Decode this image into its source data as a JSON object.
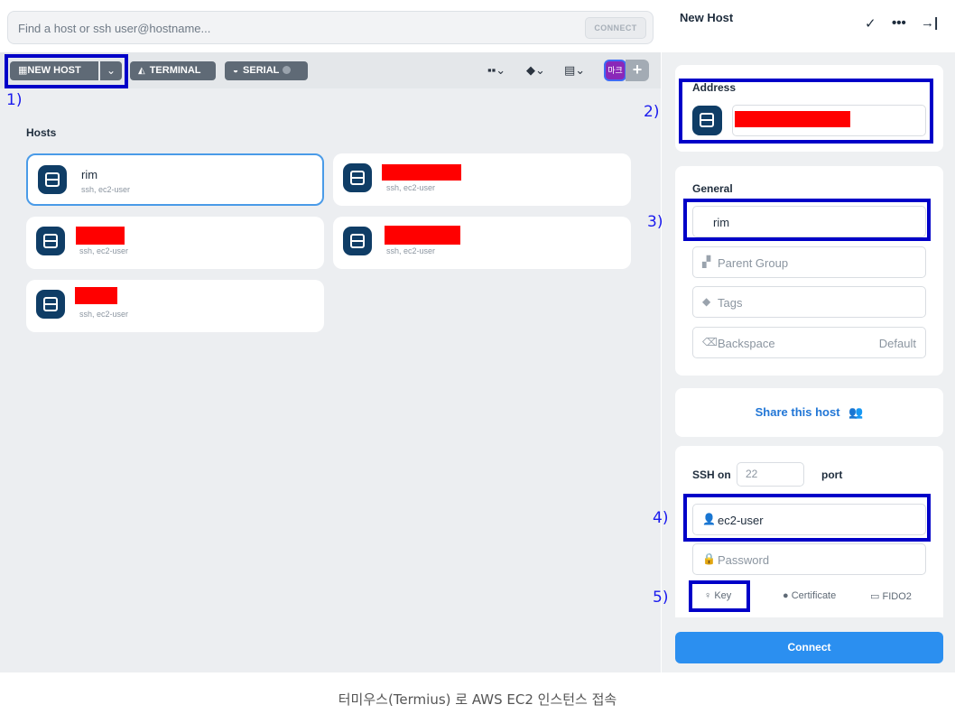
{
  "search": {
    "placeholder": "Find a host or ssh user@hostname...",
    "connect_label": "CONNECT"
  },
  "toolbar": {
    "new_host_label": "NEW HOST",
    "terminal_label": "TERMINAL",
    "serial_label": "SERIAL",
    "avatar_text": "마크"
  },
  "hosts": {
    "title": "Hosts",
    "items": [
      {
        "name": "rim",
        "sub": "ssh, ec2-user"
      },
      {
        "name": "",
        "sub": "ssh, ec2-user"
      },
      {
        "name": "",
        "sub": "ssh, ec2-user"
      },
      {
        "name": "",
        "sub": "ssh, ec2-user"
      },
      {
        "name": "",
        "sub": "ssh, ec2-user"
      }
    ]
  },
  "panel": {
    "title": "New Host",
    "address": {
      "title": "Address"
    },
    "general": {
      "title": "General",
      "label_value": "rim",
      "parent_group": "Parent Group",
      "tags": "Tags",
      "backspace": "Backspace",
      "backspace_value": "Default"
    },
    "share_label": "Share this host",
    "ssh": {
      "ssh_on": "SSH on",
      "port_value": "22",
      "port_label": "port",
      "username": "ec2-user",
      "password_placeholder": "Password",
      "key_tab": "Key",
      "certificate_tab": "Certificate",
      "fido_tab": "FIDO2"
    },
    "connect_label": "Connect"
  },
  "annotations": [
    "1)",
    "2)",
    "3)",
    "4)",
    "5)"
  ],
  "caption": "터미우스(Termius) 로 AWS EC2 인스턴스 접속",
  "colors": {
    "accent": "#2b8ff0",
    "annotation": "#0000c8",
    "redaction": "#ff0000",
    "host_icon": "#0f3d66"
  }
}
